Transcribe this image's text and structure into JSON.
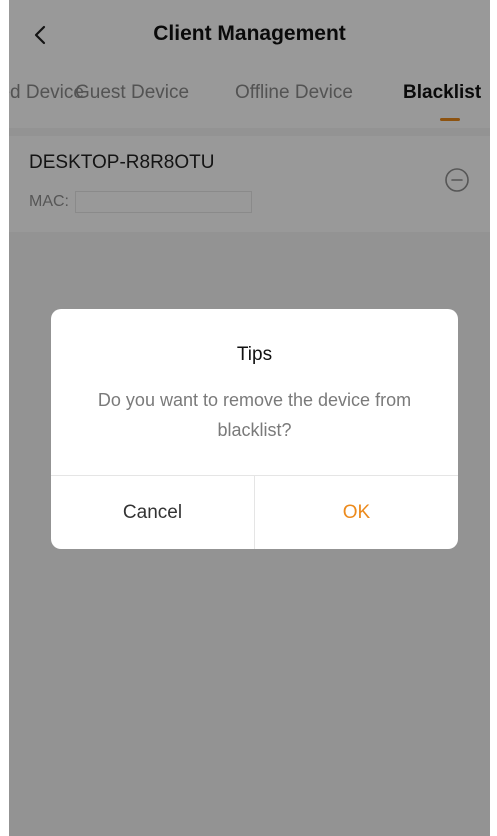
{
  "header": {
    "title": "Client Management",
    "back_icon": "chevron-left-icon"
  },
  "tabs": [
    {
      "label": "Wired Device",
      "visible_text": "vice",
      "active": false
    },
    {
      "label": "Guest Device",
      "active": false
    },
    {
      "label": "Offline Device",
      "active": false
    },
    {
      "label": "Blacklist",
      "active": true
    }
  ],
  "device": {
    "name": "DESKTOP-R8R8OTU",
    "mac_label": "MAC:",
    "remove_icon": "minus-circle-icon"
  },
  "dialog": {
    "title": "Tips",
    "message": "Do you want to remove the device from blacklist?",
    "cancel_label": "Cancel",
    "ok_label": "OK"
  },
  "colors": {
    "accent": "#ec8a1c",
    "overlay": "rgba(0,0,0,0.40)"
  }
}
